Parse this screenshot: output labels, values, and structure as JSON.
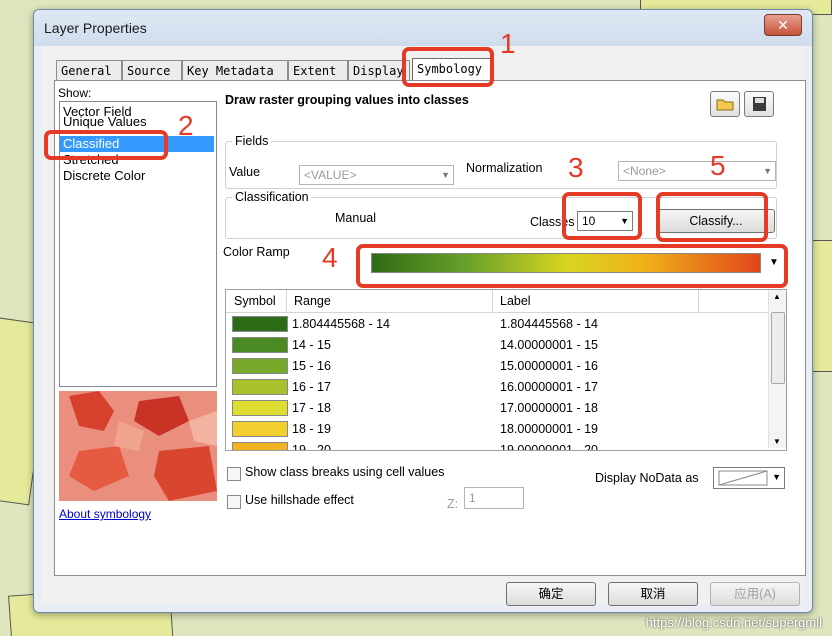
{
  "window": {
    "title": "Layer Properties",
    "close_glyph": "✕"
  },
  "tabs": [
    "General",
    "Source",
    "Key Metadata",
    "Extent",
    "Display",
    "Symbology"
  ],
  "active_tab": "Symbology",
  "show": {
    "label": "Show:",
    "items": [
      "Vector Field",
      "Unique Values",
      "Classified",
      "Stretched",
      "Discrete Color"
    ],
    "selected": "Classified"
  },
  "about_link": "About symbology",
  "header": "Draw raster grouping values into classes",
  "fields": {
    "title": "Fields",
    "value_label": "Value",
    "value": "<VALUE>",
    "normalization_label": "Normalization",
    "normalization": "<None>"
  },
  "classification": {
    "title": "Classification",
    "method": "Manual",
    "classes_label": "Classes",
    "classes_value": "10",
    "classify_button": "Classify..."
  },
  "color_ramp": {
    "label": "Color Ramp",
    "colors": [
      "#2e6b16",
      "#6aa22a",
      "#d8d520",
      "#f0b21a",
      "#e0461a"
    ]
  },
  "table": {
    "headers": [
      "Symbol",
      "Range",
      "Label"
    ],
    "rows": [
      {
        "color": "#2d6b17",
        "range": "1.804445568 - 14",
        "label": "1.804445568 - 14"
      },
      {
        "color": "#4b8a22",
        "range": "14 - 15",
        "label": "14.00000001 - 15"
      },
      {
        "color": "#79a92a",
        "range": "15 - 16",
        "label": "15.00000001 - 16"
      },
      {
        "color": "#a8c22d",
        "range": "16 - 17",
        "label": "16.00000001 - 17"
      },
      {
        "color": "#dedc30",
        "range": "17 - 18",
        "label": "17.00000001 - 18"
      },
      {
        "color": "#f2cf2f",
        "range": "18 - 19",
        "label": "18.00000001 - 19"
      },
      {
        "color": "#f0b21f",
        "range": "19 - 20",
        "label": "19.00000001 - 20"
      }
    ]
  },
  "options": {
    "show_breaks": "Show class breaks using cell values",
    "hillshade": "Use hillshade effect",
    "z_label": "Z:",
    "z_value": "1",
    "nodata_label": "Display NoData as"
  },
  "buttons": {
    "ok": "确定",
    "cancel": "取消",
    "apply": "应用(A)"
  },
  "annotations": [
    "1",
    "2",
    "3",
    "4",
    "5"
  ],
  "watermark": "https://blog.csdn.net/supergmll"
}
